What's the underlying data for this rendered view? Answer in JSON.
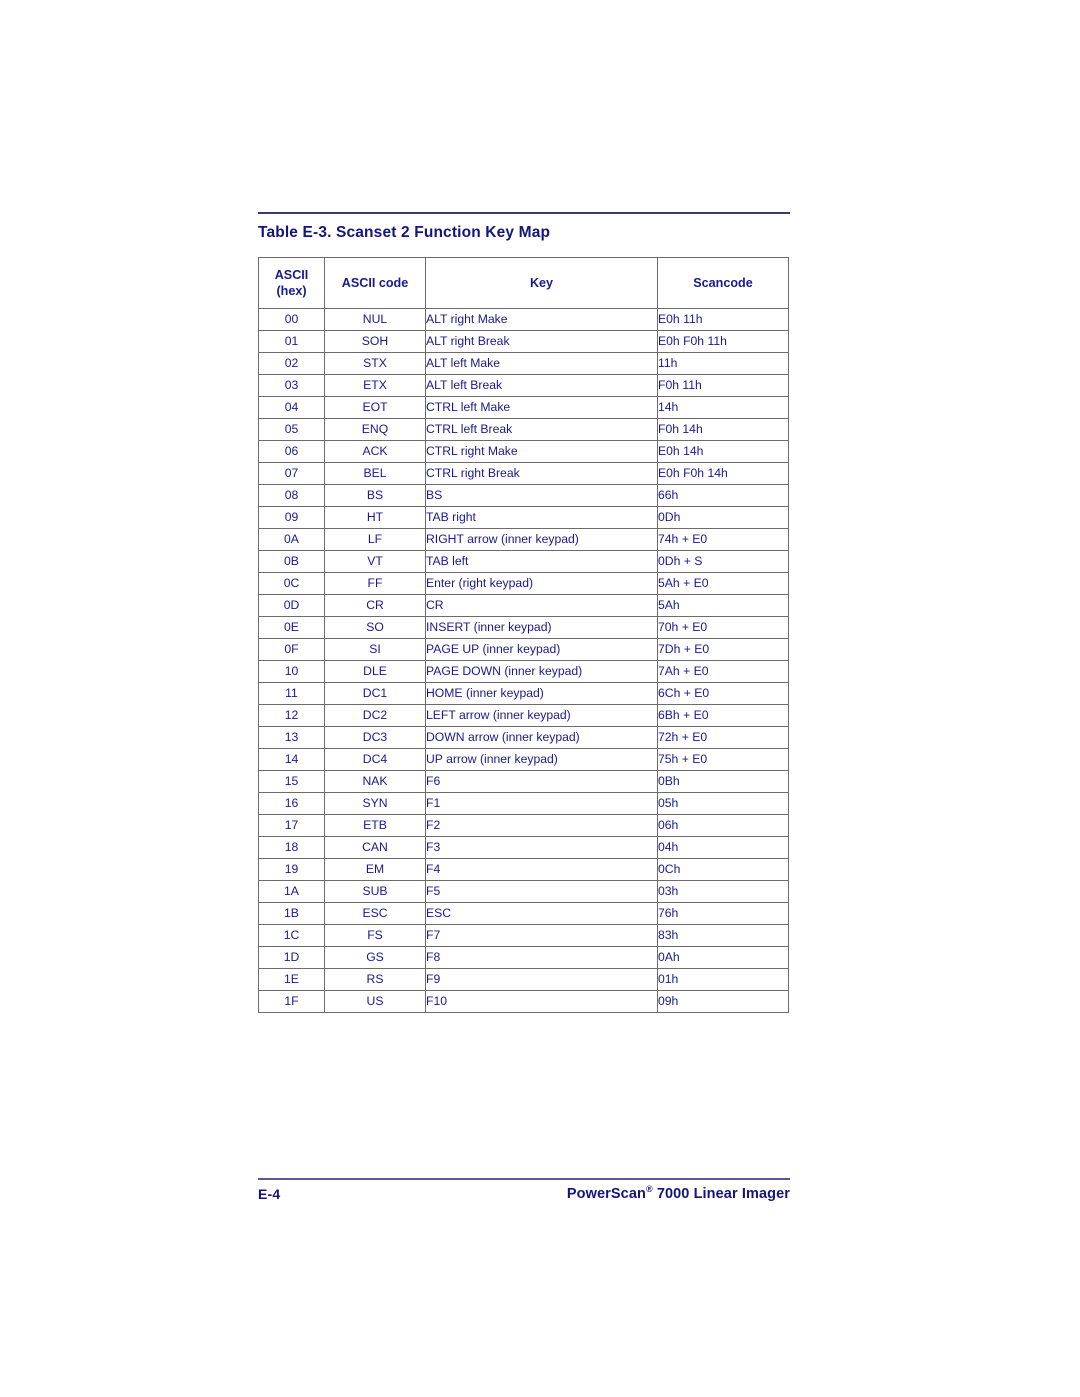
{
  "document": {
    "table_title": "Table E-3. Scanset 2 Function Key Map",
    "accent_color": "#1a1a8c",
    "rule_color": "#3b3b72"
  },
  "table": {
    "headers": {
      "ascii_hex_line1": "ASCII",
      "ascii_hex_line2": "(hex)",
      "ascii_code": "ASCII code",
      "key": "Key",
      "scancode": "Scancode"
    },
    "rows": [
      {
        "hex": "00",
        "code": "NUL",
        "key": "ALT right Make",
        "scan": "E0h 11h"
      },
      {
        "hex": "01",
        "code": "SOH",
        "key": "ALT right Break",
        "scan": "E0h F0h 11h"
      },
      {
        "hex": "02",
        "code": "STX",
        "key": "ALT left Make",
        "scan": "11h"
      },
      {
        "hex": "03",
        "code": "ETX",
        "key": "ALT left Break",
        "scan": "F0h 11h"
      },
      {
        "hex": "04",
        "code": "EOT",
        "key": "CTRL left Make",
        "scan": "14h"
      },
      {
        "hex": "05",
        "code": "ENQ",
        "key": "CTRL left Break",
        "scan": "F0h 14h"
      },
      {
        "hex": "06",
        "code": "ACK",
        "key": "CTRL right Make",
        "scan": "E0h 14h"
      },
      {
        "hex": "07",
        "code": "BEL",
        "key": "CTRL right Break",
        "scan": "E0h F0h 14h"
      },
      {
        "hex": "08",
        "code": "BS",
        "key": "BS",
        "scan": "66h"
      },
      {
        "hex": "09",
        "code": "HT",
        "key": "TAB right",
        "scan": "0Dh"
      },
      {
        "hex": "0A",
        "code": "LF",
        "key": "RIGHT arrow (inner keypad)",
        "scan": "74h + E0"
      },
      {
        "hex": "0B",
        "code": "VT",
        "key": "TAB left",
        "scan": "0Dh + S"
      },
      {
        "hex": "0C",
        "code": "FF",
        "key": "Enter (right keypad)",
        "scan": "5Ah + E0"
      },
      {
        "hex": "0D",
        "code": "CR",
        "key": "CR",
        "scan": "5Ah"
      },
      {
        "hex": "0E",
        "code": "SO",
        "key": "INSERT (inner keypad)",
        "scan": "70h + E0"
      },
      {
        "hex": "0F",
        "code": "SI",
        "key": "PAGE UP (inner keypad)",
        "scan": "7Dh + E0"
      },
      {
        "hex": "10",
        "code": "DLE",
        "key": "PAGE DOWN (inner keypad)",
        "scan": "7Ah + E0"
      },
      {
        "hex": "11",
        "code": "DC1",
        "key": "HOME (inner keypad)",
        "scan": "6Ch + E0"
      },
      {
        "hex": "12",
        "code": "DC2",
        "key": "LEFT arrow (inner keypad)",
        "scan": "6Bh + E0"
      },
      {
        "hex": "13",
        "code": "DC3",
        "key": "DOWN arrow (inner keypad)",
        "scan": "72h + E0"
      },
      {
        "hex": "14",
        "code": "DC4",
        "key": "UP arrow (inner keypad)",
        "scan": "75h + E0"
      },
      {
        "hex": "15",
        "code": "NAK",
        "key": "F6",
        "scan": "0Bh"
      },
      {
        "hex": "16",
        "code": "SYN",
        "key": "F1",
        "scan": "05h"
      },
      {
        "hex": "17",
        "code": "ETB",
        "key": "F2",
        "scan": "06h"
      },
      {
        "hex": "18",
        "code": "CAN",
        "key": "F3",
        "scan": "04h"
      },
      {
        "hex": "19",
        "code": "EM",
        "key": "F4",
        "scan": "0Ch"
      },
      {
        "hex": "1A",
        "code": "SUB",
        "key": "F5",
        "scan": "03h"
      },
      {
        "hex": "1B",
        "code": "ESC",
        "key": "ESC",
        "scan": "76h"
      },
      {
        "hex": "1C",
        "code": "FS",
        "key": "F7",
        "scan": "83h"
      },
      {
        "hex": "1D",
        "code": "GS",
        "key": "F8",
        "scan": "0Ah"
      },
      {
        "hex": "1E",
        "code": "RS",
        "key": "F9",
        "scan": "01h"
      },
      {
        "hex": "1F",
        "code": "US",
        "key": "F10",
        "scan": "09h"
      }
    ]
  },
  "footer": {
    "page_number": "E-4",
    "product_name": "PowerScan",
    "product_mark": "®",
    "product_suffix": " 7000 Linear Imager"
  }
}
